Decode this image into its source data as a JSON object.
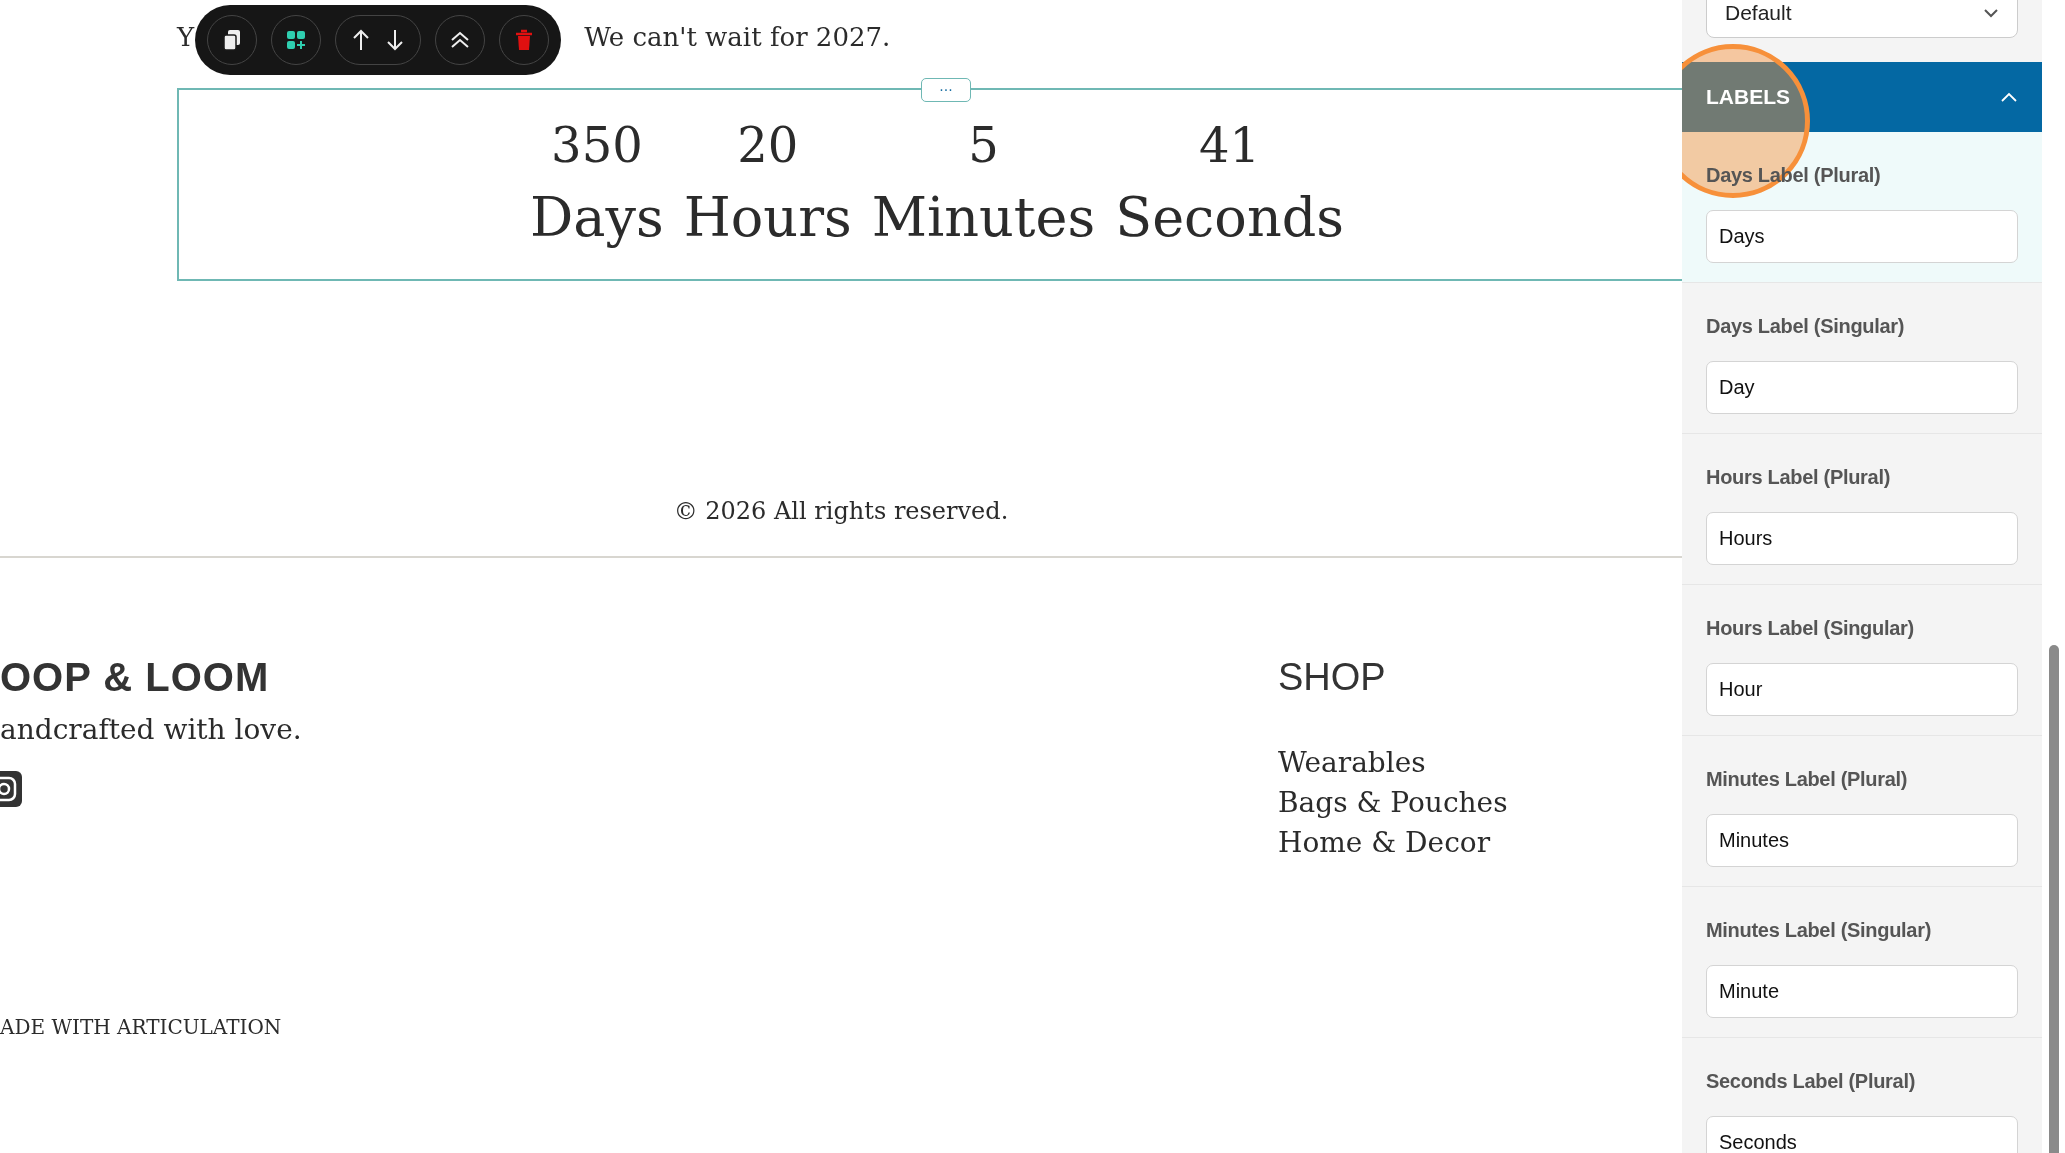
{
  "intro_text": {
    "lead": "Y",
    "rest": "We can't wait for 2027."
  },
  "toolbar": {
    "buttons": [
      {
        "kind": "copy"
      },
      {
        "kind": "add-block"
      },
      {
        "kind": "move"
      },
      {
        "kind": "collapse"
      },
      {
        "kind": "delete"
      }
    ]
  },
  "countdown": {
    "handle": "···",
    "units": [
      {
        "value": "350",
        "label": "Days"
      },
      {
        "value": "20",
        "label": "Hours"
      },
      {
        "value": "5",
        "label": "Minutes"
      },
      {
        "value": "41",
        "label": "Seconds"
      }
    ]
  },
  "copyright": "© 2026 All rights reserved.",
  "footer": {
    "brand": "OOP & LOOM",
    "tagline": "andcrafted with love.",
    "shop_title": "SHOP",
    "shop_links": [
      "Wearables",
      "Bags & Pouches",
      "Home & Decor"
    ],
    "credit": "ADE WITH ARTICULATION"
  },
  "panel": {
    "select_value": "Default",
    "section": {
      "title": "LABELS",
      "expanded": true
    },
    "fields": [
      {
        "label": "Days Label (Plural)",
        "value": "Days",
        "selected": true
      },
      {
        "label": "Days Label (Singular)",
        "value": "Day",
        "selected": false
      },
      {
        "label": "Hours Label (Plural)",
        "value": "Hours",
        "selected": false
      },
      {
        "label": "Hours Label (Singular)",
        "value": "Hour",
        "selected": false
      },
      {
        "label": "Minutes Label (Plural)",
        "value": "Minutes",
        "selected": false
      },
      {
        "label": "Minutes Label (Singular)",
        "value": "Minute",
        "selected": false
      },
      {
        "label": "Seconds Label (Plural)",
        "value": "Seconds",
        "selected": false
      }
    ]
  }
}
